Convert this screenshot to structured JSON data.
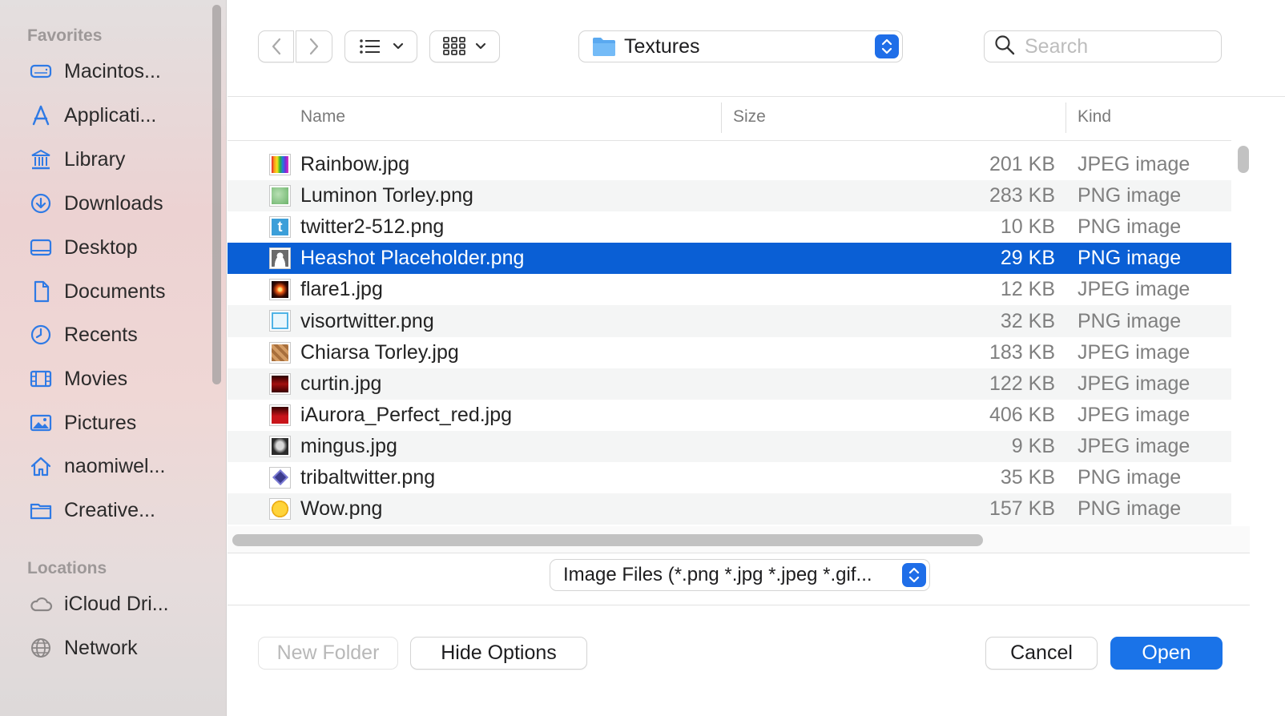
{
  "sidebar": {
    "favorites_title": "Favorites",
    "locations_title": "Locations",
    "favorites": [
      {
        "label": "Macintos...",
        "icon": "hard-drive-icon"
      },
      {
        "label": "Applicati...",
        "icon": "applications-icon"
      },
      {
        "label": "Library",
        "icon": "library-icon"
      },
      {
        "label": "Downloads",
        "icon": "downloads-icon"
      },
      {
        "label": "Desktop",
        "icon": "desktop-icon"
      },
      {
        "label": "Documents",
        "icon": "document-icon"
      },
      {
        "label": "Recents",
        "icon": "clock-icon"
      },
      {
        "label": "Movies",
        "icon": "film-icon"
      },
      {
        "label": "Pictures",
        "icon": "photo-icon"
      },
      {
        "label": "naomiwel...",
        "icon": "home-icon"
      },
      {
        "label": "Creative...",
        "icon": "folder-icon"
      }
    ],
    "locations": [
      {
        "label": "iCloud Dri...",
        "icon": "cloud-icon"
      },
      {
        "label": "Network",
        "icon": "globe-icon"
      }
    ]
  },
  "toolbar": {
    "current_folder": "Textures",
    "search_placeholder": "Search"
  },
  "columns": {
    "name": "Name",
    "size": "Size",
    "kind": "Kind"
  },
  "files": [
    {
      "name": "Rainbow.jpg",
      "size": "201 KB",
      "kind": "JPEG image",
      "thumb": "rainbow"
    },
    {
      "name": "Luminon Torley.png",
      "size": "283 KB",
      "kind": "PNG image",
      "thumb": "green"
    },
    {
      "name": "twitter2-512.png",
      "size": "10 KB",
      "kind": "PNG image",
      "thumb": "twitter"
    },
    {
      "name": "Heashot Placeholder.png",
      "size": "29 KB",
      "kind": "PNG image",
      "thumb": "person",
      "selected": true
    },
    {
      "name": "flare1.jpg",
      "size": "12 KB",
      "kind": "JPEG image",
      "thumb": "flare"
    },
    {
      "name": "visortwitter.png",
      "size": "32 KB",
      "kind": "PNG image",
      "thumb": "bird"
    },
    {
      "name": "Chiarsa Torley.jpg",
      "size": "183 KB",
      "kind": "JPEG image",
      "thumb": "brown"
    },
    {
      "name": "curtin.jpg",
      "size": "122 KB",
      "kind": "JPEG image",
      "thumb": "curtain"
    },
    {
      "name": "iAurora_Perfect_red.jpg",
      "size": "406 KB",
      "kind": "JPEG image",
      "thumb": "aurora"
    },
    {
      "name": "mingus.jpg",
      "size": "9 KB",
      "kind": "JPEG image",
      "thumb": "face"
    },
    {
      "name": "tribaltwitter.png",
      "size": "35 KB",
      "kind": "PNG image",
      "thumb": "diamond"
    },
    {
      "name": "Wow.png",
      "size": "157 KB",
      "kind": "PNG image",
      "thumb": "wow"
    }
  ],
  "file_format": "Image Files (*.png *.jpg *.jpeg *.gif...",
  "buttons": {
    "new_folder": "New Folder",
    "hide_options": "Hide Options",
    "cancel": "Cancel",
    "open": "Open"
  },
  "colors": {
    "accent": "#1a73e8",
    "selection": "#0a5fd5",
    "sidebar_icon": "#2f7ae5"
  }
}
